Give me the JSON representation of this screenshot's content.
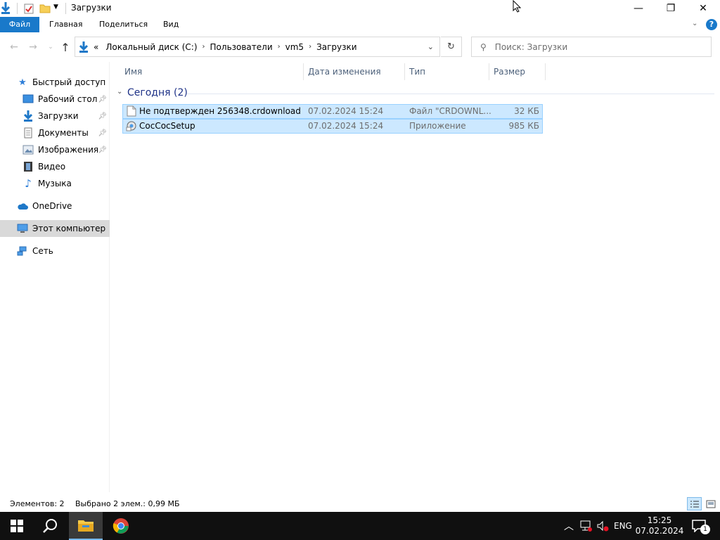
{
  "window": {
    "title": "Загрузки",
    "minimize_glyph": "—",
    "restore_glyph": "❐",
    "close_glyph": "✕"
  },
  "ribbon": {
    "tabs": [
      "Файл",
      "Главная",
      "Поделиться",
      "Вид"
    ]
  },
  "address": {
    "overflow": "«",
    "crumbs": [
      "Локальный диск (C:)",
      "Пользователи",
      "vm5",
      "Загрузки"
    ]
  },
  "search": {
    "placeholder": "Поиск: Загрузки"
  },
  "nav": {
    "items": [
      {
        "label": "Быстрый доступ",
        "icon": "star-icon"
      },
      {
        "label": "Рабочий стол",
        "icon": "desktop-icon",
        "pinned": true
      },
      {
        "label": "Загрузки",
        "icon": "download-arrow-icon",
        "pinned": true
      },
      {
        "label": "Документы",
        "icon": "documents-icon",
        "pinned": true
      },
      {
        "label": "Изображения",
        "icon": "pictures-icon",
        "pinned": true
      },
      {
        "label": "Видео",
        "icon": "video-icon"
      },
      {
        "label": "Музыка",
        "icon": "music-icon"
      },
      {
        "label": "OneDrive",
        "icon": "cloud-icon"
      },
      {
        "label": "Этот компьютер",
        "icon": "computer-icon"
      },
      {
        "label": "Сеть",
        "icon": "network-icon"
      }
    ]
  },
  "columns": [
    "Имя",
    "Дата изменения",
    "Тип",
    "Размер"
  ],
  "group": {
    "title": "Сегодня (2)"
  },
  "files": [
    {
      "name": "Не подтвержден 256348.crdownload",
      "date": "07.02.2024 15:24",
      "type": "Файл \"CRDOWNL...",
      "size": "32 КБ"
    },
    {
      "name": "CocCocSetup",
      "date": "07.02.2024 15:24",
      "type": "Приложение",
      "size": "985 КБ"
    }
  ],
  "status": {
    "count": "Элементов: 2",
    "selected": "Выбрано 2 элем.: 0,99 МБ"
  },
  "taskbar": {
    "lang": "ENG",
    "time": "15:25",
    "date": "07.02.2024",
    "notif_count": "1"
  },
  "colors": {
    "accent": "#1979ca",
    "selection": "#cce8ff",
    "selection_border": "#99d1ff",
    "taskbar": "#101010"
  }
}
